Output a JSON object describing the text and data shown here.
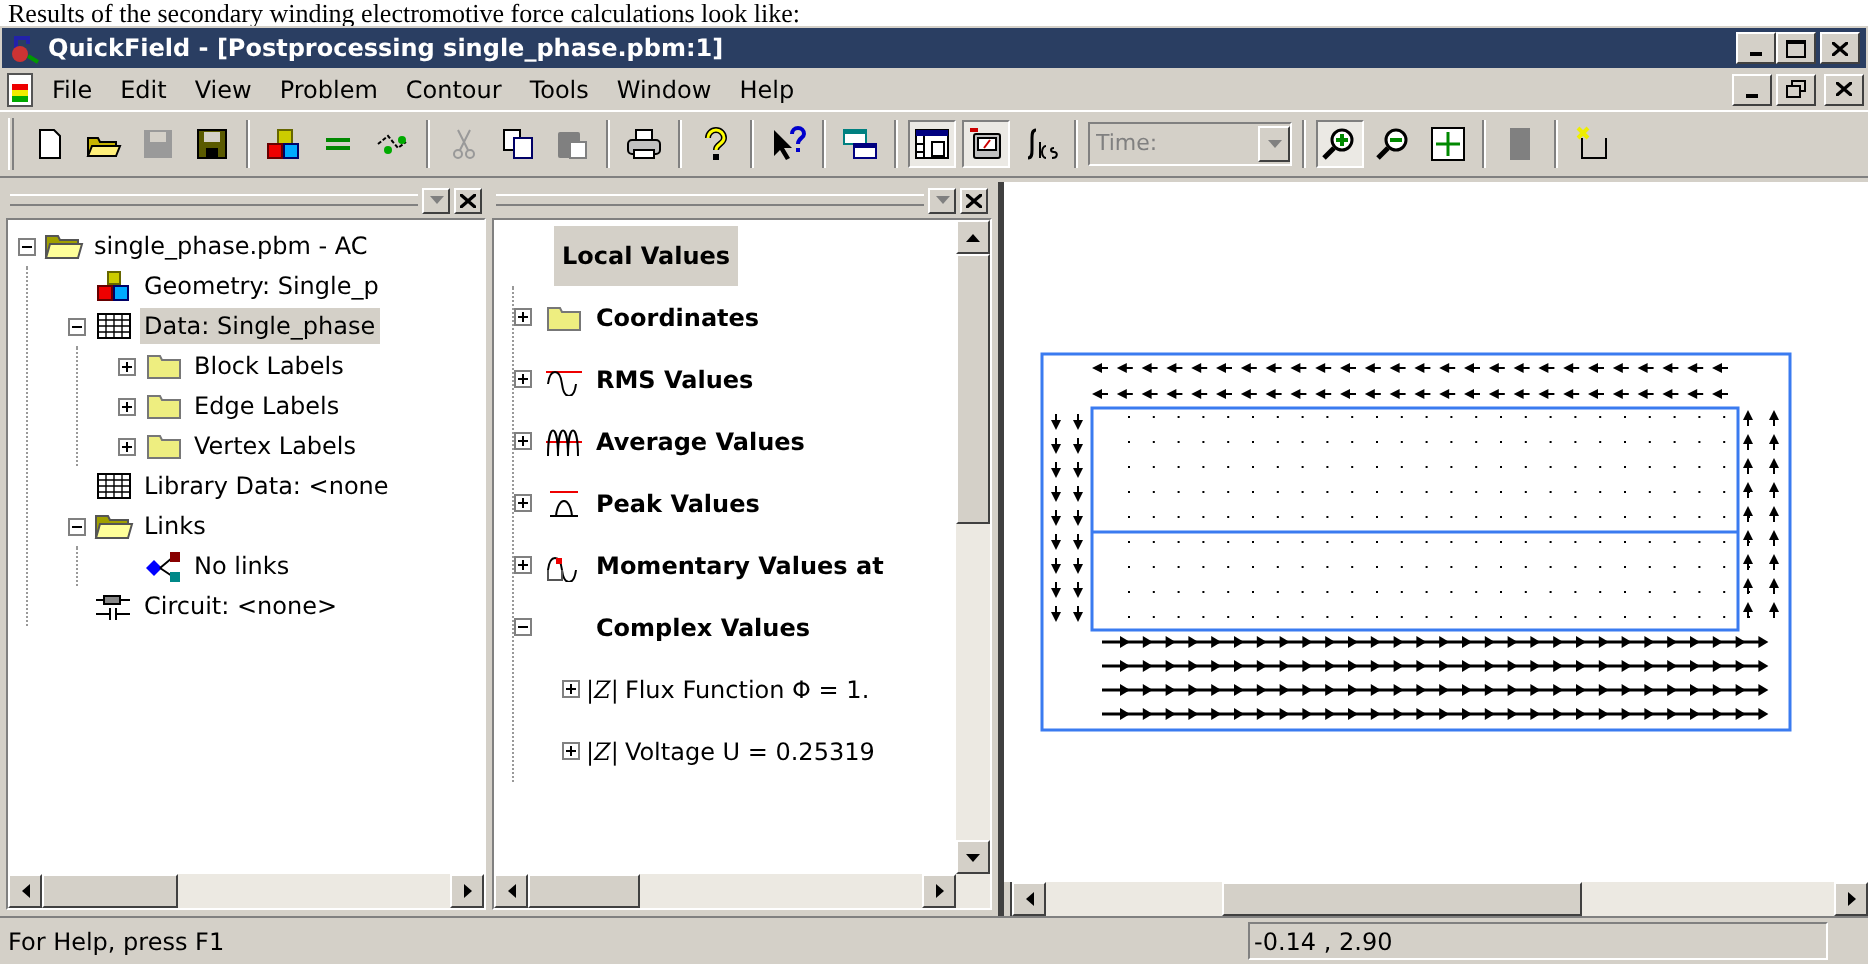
{
  "caption": "Results of the secondary winding electromotive force calculations look like:",
  "window": {
    "title": "QuickField - [Postprocessing single_phase.pbm:1]"
  },
  "menu": [
    {
      "label": "File"
    },
    {
      "label": "Edit"
    },
    {
      "label": "View"
    },
    {
      "label": "Problem"
    },
    {
      "label": "Contour"
    },
    {
      "label": "Tools"
    },
    {
      "label": "Window"
    },
    {
      "label": "Help"
    }
  ],
  "toolbar": [
    {
      "kind": "new",
      "pressed": false
    },
    {
      "kind": "open",
      "pressed": false
    },
    {
      "kind": "save-disabled",
      "pressed": false
    },
    {
      "kind": "save",
      "pressed": false
    },
    {
      "kind": "sep"
    },
    {
      "kind": "blocks",
      "pressed": false
    },
    {
      "kind": "equals",
      "pressed": false
    },
    {
      "kind": "link",
      "pressed": false
    },
    {
      "kind": "sep"
    },
    {
      "kind": "cut",
      "pressed": false
    },
    {
      "kind": "copy",
      "pressed": false
    },
    {
      "kind": "paste",
      "pressed": false
    },
    {
      "kind": "sep"
    },
    {
      "kind": "print",
      "pressed": false
    },
    {
      "kind": "sep"
    },
    {
      "kind": "help",
      "pressed": false
    },
    {
      "kind": "sep"
    },
    {
      "kind": "whatsthis",
      "pressed": false
    },
    {
      "kind": "sep"
    },
    {
      "kind": "windows",
      "pressed": false
    },
    {
      "kind": "sep"
    },
    {
      "kind": "table",
      "pressed": true
    },
    {
      "kind": "meter",
      "pressed": true
    },
    {
      "kind": "integral",
      "pressed": false
    },
    {
      "kind": "sep"
    },
    {
      "kind": "time"
    },
    {
      "kind": "sep"
    },
    {
      "kind": "zoomin",
      "pressed": true
    },
    {
      "kind": "zoomout",
      "pressed": false
    },
    {
      "kind": "fit",
      "pressed": false
    },
    {
      "kind": "sep"
    },
    {
      "kind": "gray",
      "pressed": false
    },
    {
      "kind": "sep"
    },
    {
      "kind": "corner",
      "pressed": false
    }
  ],
  "time_field": {
    "placeholder": "Time:",
    "disabled": true
  },
  "problem_tree": [
    {
      "label": "single_phase.pbm - AC",
      "kind": "openfolder",
      "expanded": true,
      "selected": false,
      "children": [
        {
          "label": "Geometry: Single_p",
          "kind": "blocks",
          "selected": false
        },
        {
          "label": "Data: Single_phase",
          "kind": "grid",
          "expanded": true,
          "selected": true,
          "children": [
            {
              "label": "Block Labels",
              "kind": "folder",
              "expanded": false,
              "selected": false
            },
            {
              "label": "Edge Labels",
              "kind": "folder",
              "expanded": false,
              "selected": false
            },
            {
              "label": "Vertex Labels",
              "kind": "folder",
              "expanded": false,
              "selected": false
            }
          ]
        },
        {
          "label": "Library Data: <none",
          "kind": "grid",
          "selected": false
        },
        {
          "label": "Links",
          "kind": "openfolder",
          "expanded": true,
          "selected": false,
          "children": [
            {
              "label": "No links",
              "kind": "links",
              "selected": false
            }
          ]
        },
        {
          "label": "Circuit: <none>",
          "kind": "circuit",
          "selected": false
        }
      ]
    }
  ],
  "values_tree": {
    "heading": "Local Values",
    "heading_selected": true,
    "items": [
      {
        "label": "Coordinates",
        "kind": "folder",
        "expanded": false
      },
      {
        "label": "RMS Values",
        "kind": "rms",
        "expanded": false
      },
      {
        "label": "Average Values",
        "kind": "average",
        "expanded": false
      },
      {
        "label": "Peak Values",
        "kind": "peak",
        "expanded": false
      },
      {
        "label": "Momentary Values at",
        "kind": "momentary",
        "expanded": false
      },
      {
        "label": "Complex Values",
        "kind": "none",
        "expanded": true,
        "children": [
          {
            "symbol": "|Z|",
            "label": "Flux Function Φ = 1.",
            "expanded": false
          },
          {
            "symbol": "|Z|",
            "label": "Voltage U = 0.25319",
            "expanded": false
          }
        ]
      }
    ]
  },
  "status_bar": {
    "message": "For Help, press F1",
    "coordinates": "-0.14 , 2.90"
  }
}
